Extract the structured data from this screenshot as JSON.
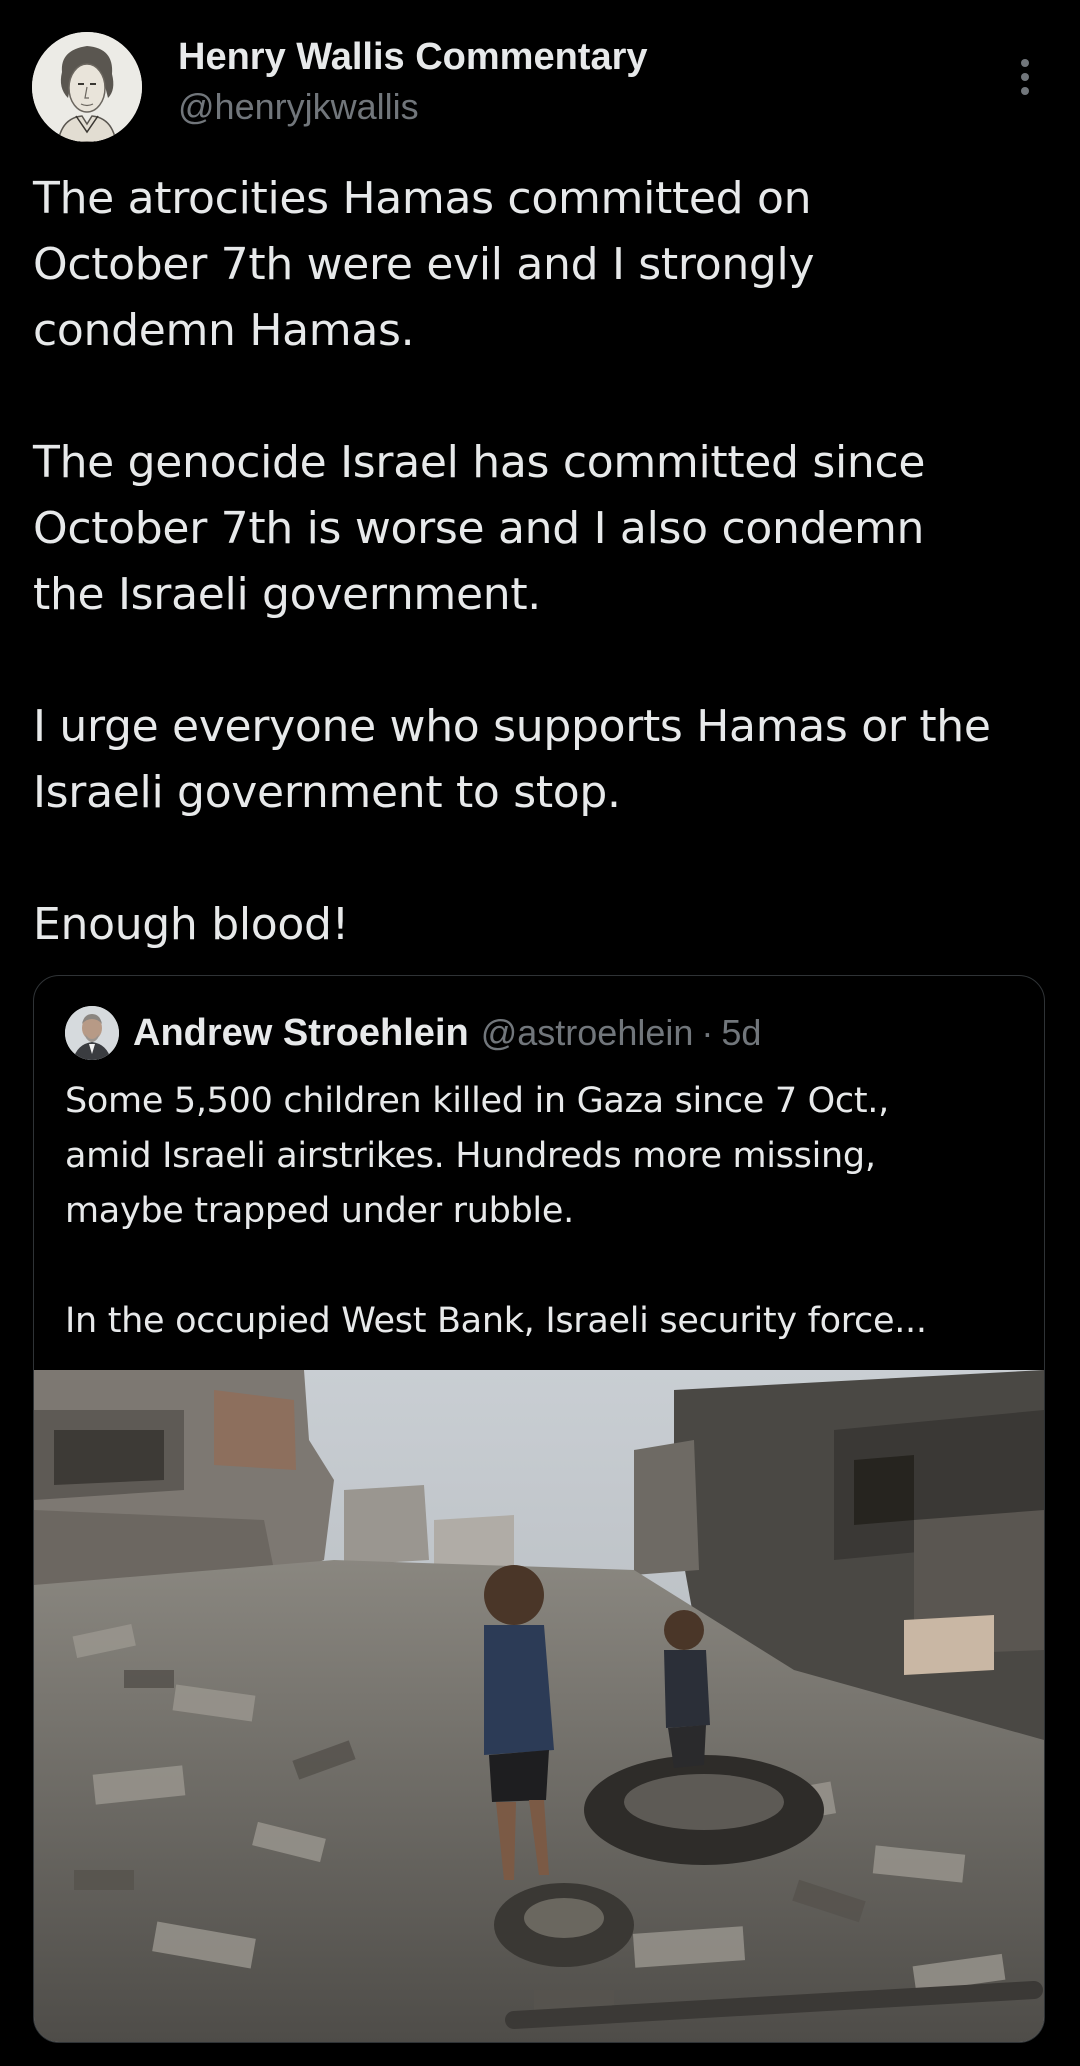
{
  "tweet": {
    "author": {
      "display_name": "Henry Wallis Commentary",
      "handle": "@henryjkwallis",
      "avatar_icon": "sketch-portrait-avatar"
    },
    "more_icon": "more-vertical-icon",
    "paragraphs": [
      [
        "The atrocities Hamas committed on",
        "October 7th were evil and I strongly",
        "condemn Hamas."
      ],
      [
        "The genocide Israel has committed since",
        "October 7th is worse and I also condemn",
        "the Israeli government."
      ],
      [
        "I urge everyone who supports Hamas or the",
        "Israeli government to stop."
      ],
      [
        "Enough blood!"
      ]
    ]
  },
  "quoted_tweet": {
    "author": {
      "display_name": "Andrew Stroehlein",
      "handle": "@astroehlein",
      "separator": "·",
      "time": "5d"
    },
    "paragraphs": [
      [
        "Some 5,500 children killed in Gaza since 7 Oct.,",
        "amid Israeli airstrikes. Hundreds more missing,",
        "maybe trapped under rubble."
      ],
      [
        "In the occupied West Bank, Israeli security force..."
      ]
    ],
    "media": {
      "type": "photo",
      "subject": "children-in-rubble-photo"
    }
  },
  "colors": {
    "background": "#000000",
    "primary_text": "#e7e9ea",
    "secondary_text": "#71767b",
    "card_border": "#2f3336"
  }
}
